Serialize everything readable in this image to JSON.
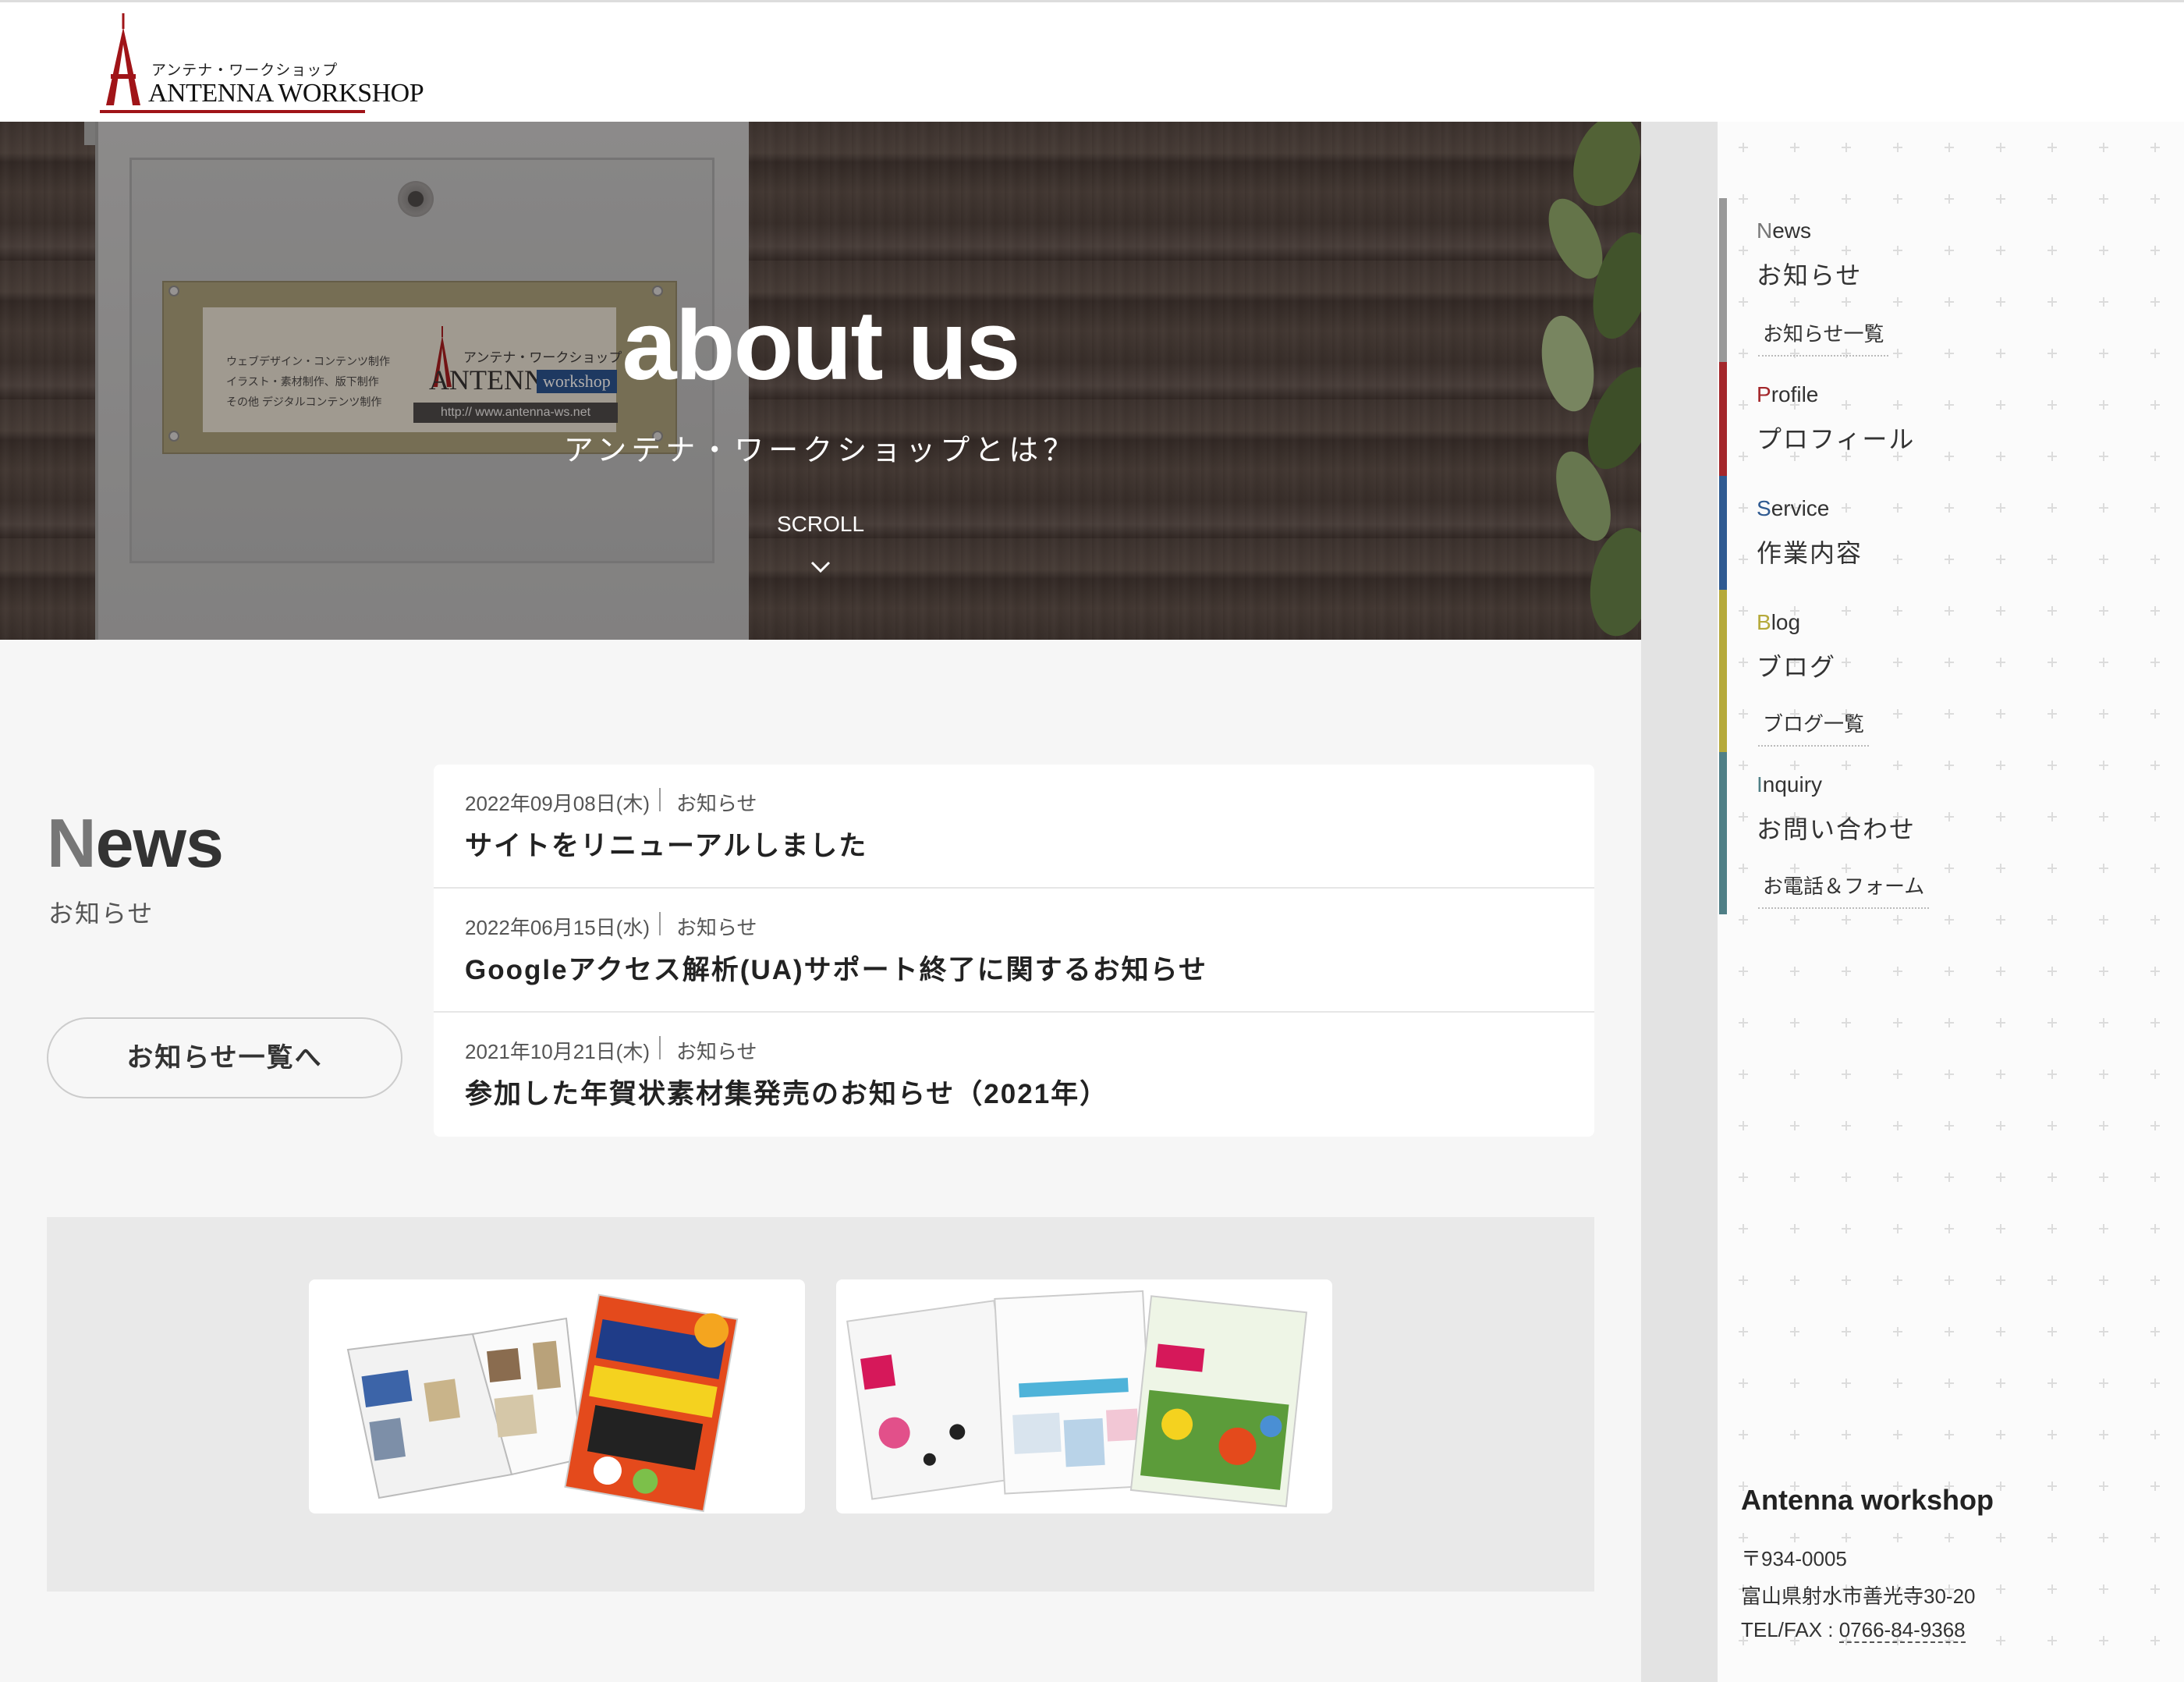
{
  "header": {
    "logo_kana": "アンテナ・ワークショップ",
    "logo_main": "ANTENNA WORKSHOP",
    "brand_color": "#a01418"
  },
  "hero": {
    "title": "about us",
    "subtitle": "アンテナ・ワークショップとは？",
    "scroll_label": "SCROLL",
    "plate_lines": [
      "ウェブデザイン・コンテンツ制作",
      "イラスト・素材制作、版下制作",
      "その他 デジタルコンテンツ制作"
    ],
    "plate_kana": "アンテナ・ワークショップ",
    "plate_logo": "ANTENNA",
    "plate_badge": "workshop",
    "plate_url": "http:// www.antenna-ws.net"
  },
  "news": {
    "heading_first": "N",
    "heading_rest": "ews",
    "subheading": "お知らせ",
    "more_button": "お知らせ一覧へ",
    "items": [
      {
        "date": "2022年09月08日(木)",
        "category": "お知らせ",
        "title": "サイトをリニューアルしました"
      },
      {
        "date": "2022年06月15日(水)",
        "category": "お知らせ",
        "title": "Googleアクセス解析(UA)サポート終了に関するお知らせ"
      },
      {
        "date": "2021年10月21日(木)",
        "category": "お知らせ",
        "title": "参加した年賀状素材集発売のお知らせ（2021年）"
      }
    ]
  },
  "banners": [
    {
      "icon": "nengajo-book-image"
    },
    {
      "icon": "design-book-image"
    }
  ],
  "sidebar": {
    "nav": [
      {
        "first": "N",
        "rest": "ews",
        "ja": "お知らせ",
        "sub": "お知らせ一覧",
        "color": "#999999"
      },
      {
        "first": "P",
        "rest": "rofile",
        "ja": "プロフィール",
        "sub": "",
        "color": "#a3262a"
      },
      {
        "first": "S",
        "rest": "ervice",
        "ja": "作業内容",
        "sub": "",
        "color": "#2f5a91"
      },
      {
        "first": "B",
        "rest": "log",
        "ja": "ブログ",
        "sub": "ブログ一覧",
        "color": "#b5a93a"
      },
      {
        "first": "I",
        "rest": "nquiry",
        "ja": "お問い合わせ",
        "sub": "お電話＆フォーム",
        "color": "#4f7f86"
      }
    ],
    "info": {
      "name": "Antenna workshop",
      "postal": "〒934-0005",
      "address": "富山県射水市善光寺30-20",
      "tel_label": "TEL/FAX : ",
      "tel": "0766-84-9368"
    }
  }
}
